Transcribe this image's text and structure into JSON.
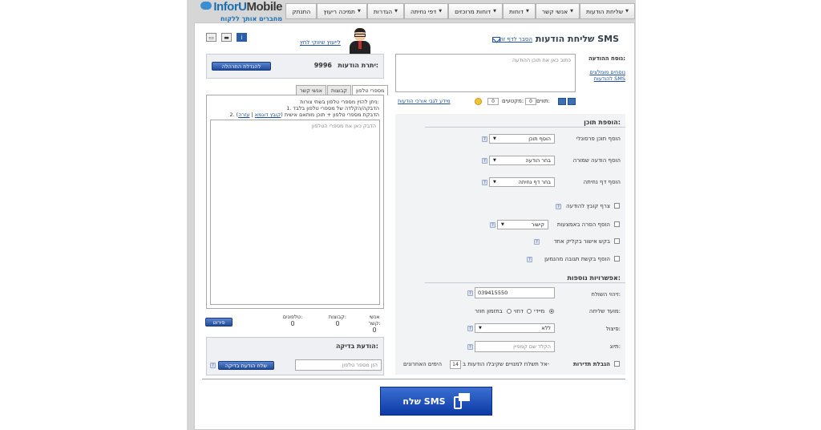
{
  "nav": {
    "items": [
      {
        "label": "שליחת הודעות",
        "has_caret": true
      },
      {
        "label": "אנשי קשר",
        "has_caret": true
      },
      {
        "label": "דוחות",
        "has_caret": true
      },
      {
        "label": "דוחות מרוכזים",
        "has_caret": true
      },
      {
        "label": "דפי נחיתה",
        "has_caret": true
      },
      {
        "label": "הגדרות",
        "has_caret": true
      },
      {
        "label": "תמיכה ריעוץ",
        "has_caret": true
      },
      {
        "label": "התנתק",
        "has_caret": false
      }
    ]
  },
  "logo": {
    "name_a": "InforU",
    "name_b": "Mobile",
    "tagline": "מחברים אותך ללקוח"
  },
  "header": {
    "title": "שליחת הודעות SMS",
    "help_link": "הסבר לדף זה",
    "update_link": "לייעוץ שיווקי לחץ"
  },
  "quota": {
    "label": "יתרת הודעות:",
    "value": "9996",
    "button": "להגדלת התרהלה"
  },
  "recipients": {
    "tabs": [
      "אנשי קשר",
      "קבוצות",
      "מספרי טלפון"
    ],
    "active_tab": "מספרי טלפון",
    "line1": "ניתן להזין מספרי טלפון בשתי צורות:",
    "line2": "1. הדבקה/הקלדה של מספרי טלפון בלבד",
    "line3_prefix": "2. הדבקת מספרי טלפון + תוכן מותאם אישית (",
    "line3_link_file": "קובץ דוגמא",
    "line3_sep": " | ",
    "line3_link_help": "עזרה",
    "line3_suffix": ")",
    "placeholder": "הדבק כאן את מספרי הטלפון",
    "stats": [
      {
        "label": "אנשי קשר:",
        "value": "0"
      },
      {
        "label": "קבוצות:",
        "value": "0"
      },
      {
        "label": "טלפונים:",
        "value": "0"
      }
    ],
    "parse_button": "פירוט"
  },
  "test": {
    "title": "הודעת בדיקה:",
    "placeholder": "הזן מספר טלפון",
    "button": "שלח הודעת בדיקה",
    "help": "?"
  },
  "message": {
    "label": "נוסח ההודעה:",
    "placeholder": "כתוב כאן את תוכן ההודעה",
    "saved_link": "נוסחים מומלצים להודעות SMS",
    "chars_label": "תווים:",
    "chars_value": "0",
    "sections_label": "מקטעים:",
    "sections_value": "0",
    "long_info_link": "מידע לגבי אורכי הודעות"
  },
  "add_content": {
    "title": "הוספת תוכן:",
    "rows": [
      {
        "label": "הוסף תוכן פרסונלי",
        "select": "הוסף תוכן"
      },
      {
        "label": "הוסף הודעה שמורה",
        "select": "בחר הודעה"
      },
      {
        "label": "הוסף דף נחיתה",
        "select": "בחר דף נחיתה"
      }
    ],
    "checks": [
      {
        "label": "צרף קובץ להודעה"
      },
      {
        "label": "הוסף הסרה באמצעות",
        "select": "קישור"
      },
      {
        "label": "בקש אישור בקליק אחד"
      },
      {
        "label": "הוסף בקשת תגובה מהנמען"
      }
    ]
  },
  "options": {
    "title": "אפשרויות נוספות:",
    "sender_label": "זיהוי השולח:",
    "sender_value": "039415550",
    "time_label": "מועד שליחה:",
    "time_options": [
      "מיידי",
      "דחוי",
      "בתזמון חוזר"
    ],
    "time_selected": "מיידי",
    "split_label": "פיצול:",
    "split_value": "ללא",
    "tag_label": "תיוג:",
    "tag_placeholder": "הקלד שם קמפיין",
    "freq_label": "הגבלת תדירות",
    "freq_text1": "אל תשלח למנויים שקיבלו הודעות ב-",
    "freq_value": "14",
    "freq_text2": "הימים האחרונים"
  },
  "send": {
    "label": "שלח SMS"
  }
}
